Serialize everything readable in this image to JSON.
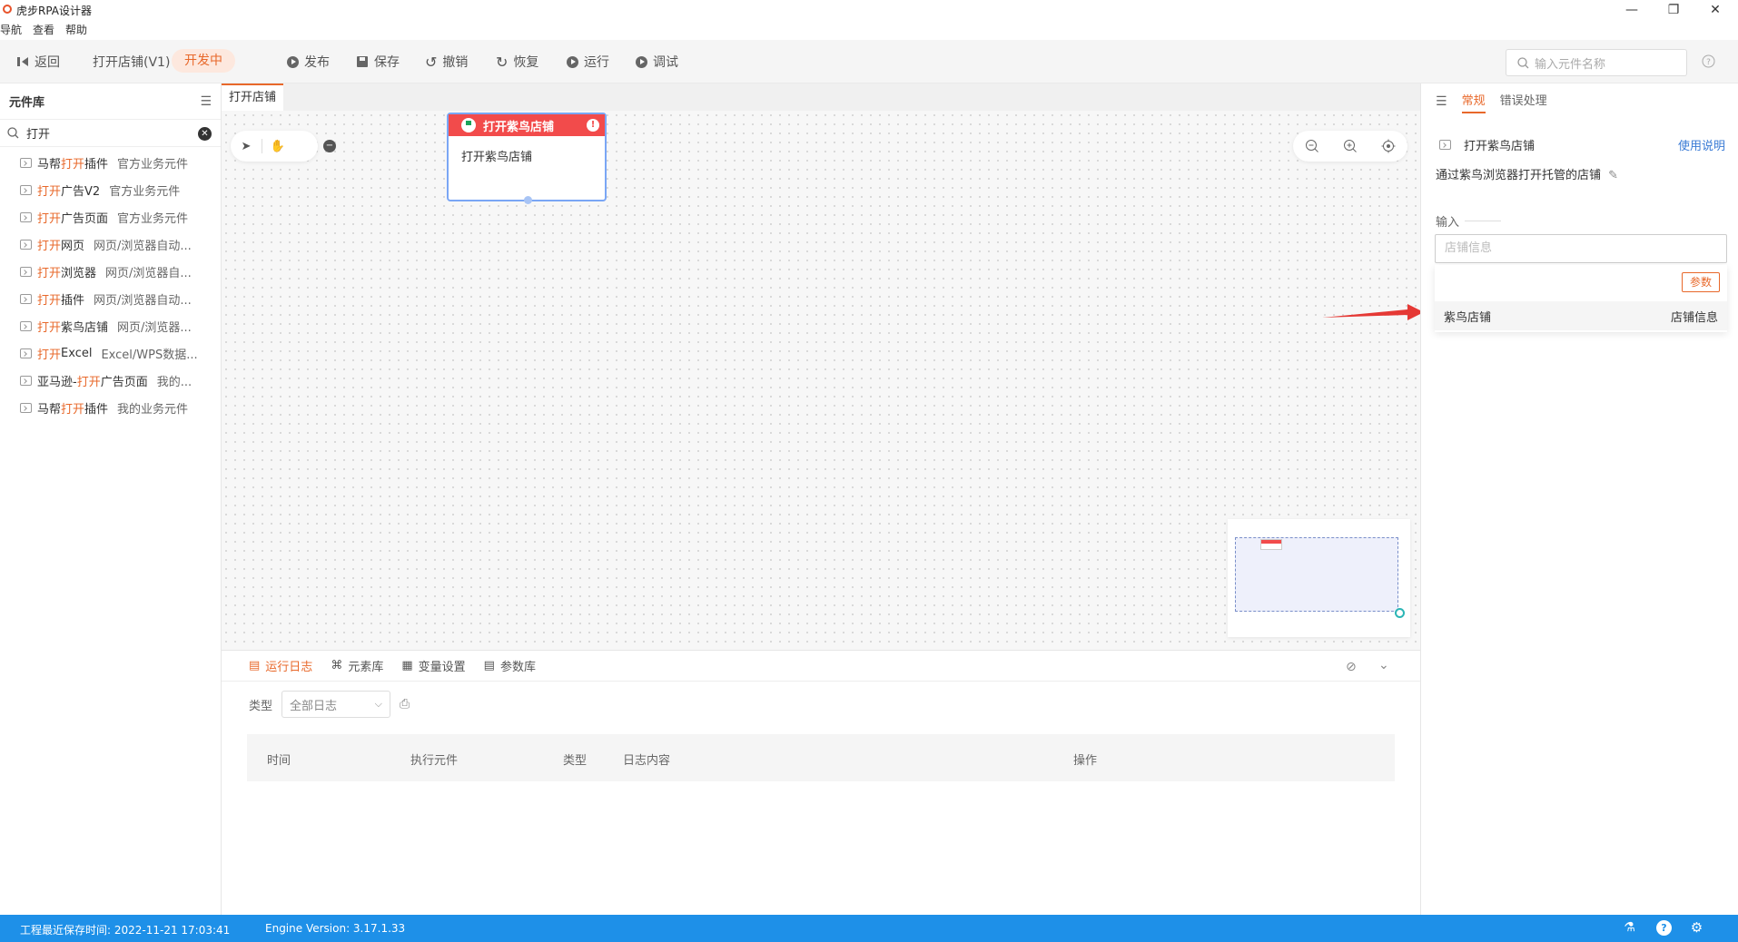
{
  "window": {
    "title": "虎步RPA设计器"
  },
  "menu": [
    "导航",
    "查看",
    "帮助"
  ],
  "toolbar": {
    "back": "返回",
    "flow_name": "打开店铺(V1)",
    "status": "开发中",
    "publish": "发布",
    "save": "保存",
    "undo": "撤销",
    "redo": "恢复",
    "run": "运行",
    "debug": "调试",
    "search_placeholder": "输入元件名称"
  },
  "left_panel": {
    "title": "元件库",
    "search_value": "打开",
    "items": [
      {
        "pre": "马帮",
        "hl": "打开",
        "post": "插件",
        "cat": "官方业务元件"
      },
      {
        "pre": "",
        "hl": "打开",
        "post": "广告V2",
        "cat": "官方业务元件"
      },
      {
        "pre": "",
        "hl": "打开",
        "post": "广告页面",
        "cat": "官方业务元件"
      },
      {
        "pre": "",
        "hl": "打开",
        "post": "网页",
        "cat": "网页/浏览器自动..."
      },
      {
        "pre": "",
        "hl": "打开",
        "post": "浏览器",
        "cat": "网页/浏览器自..."
      },
      {
        "pre": "",
        "hl": "打开",
        "post": "插件",
        "cat": "网页/浏览器自动..."
      },
      {
        "pre": "",
        "hl": "打开",
        "post": "紫鸟店铺",
        "cat": "网页/浏览器..."
      },
      {
        "pre": "",
        "hl": "打开",
        "post": "Excel",
        "cat": "Excel/WPS数据..."
      },
      {
        "pre": "亚马逊-",
        "hl": "打开",
        "post": "广告页面",
        "cat": "我的..."
      },
      {
        "pre": "马帮",
        "hl": "打开",
        "post": "插件",
        "cat": "我的业务元件"
      }
    ]
  },
  "canvas": {
    "tab": "打开店铺",
    "node": {
      "header": "打开紫鸟店铺",
      "body": "打开紫鸟店铺"
    }
  },
  "bottom_panel": {
    "tabs": [
      "运行日志",
      "元素库",
      "变量设置",
      "参数库"
    ],
    "filter_label": "类型",
    "filter_value": "全部日志",
    "columns": [
      "时间",
      "执行元件",
      "类型",
      "日志内容",
      "操作"
    ]
  },
  "right_panel": {
    "tabs": [
      "常规",
      "错误处理"
    ],
    "title": "打开紫鸟店铺",
    "help": "使用说明",
    "description": "通过紫鸟浏览器打开托管的店铺",
    "input_label": "输入",
    "input_placeholder": "店铺信息",
    "param_button": "参数",
    "option_name": "紫鸟店铺",
    "option_type": "店铺信息"
  },
  "statusbar": {
    "saved": "工程最近保存时间: 2022-11-21 17:03:41",
    "engine": "Engine Version: 3.17.1.33"
  },
  "colors": {
    "accent": "#e8682a",
    "status_bar": "#1e90e8",
    "node_header": "#f24b4b"
  }
}
